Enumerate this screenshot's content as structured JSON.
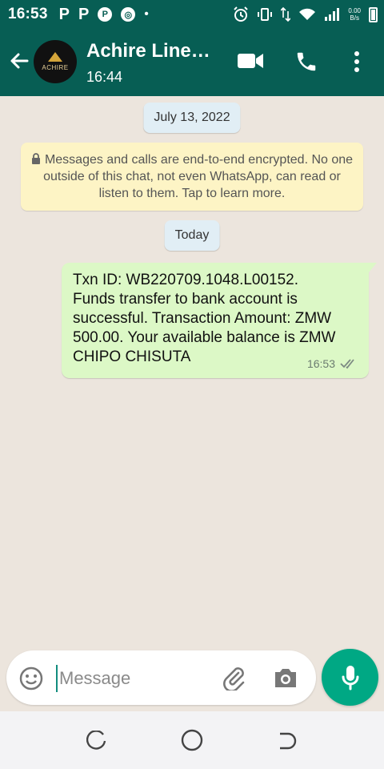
{
  "status_bar": {
    "time": "16:53",
    "left_icons": [
      "P",
      "P",
      "P",
      "chrome"
    ],
    "dot": "•",
    "speed_top": "0.00",
    "speed_bottom": "B/s",
    "right_icons": [
      "alarm-icon",
      "vibrate-icon",
      "data-arrows-icon",
      "wifi-icon",
      "signal-icon",
      "battery-icon"
    ]
  },
  "header": {
    "contact_name": "Achire Line…",
    "last_seen": "16:44",
    "avatar_text": "ACHIRE",
    "icons": [
      "back-arrow-icon",
      "video-call-icon",
      "voice-call-icon",
      "more-options-icon"
    ]
  },
  "chat": {
    "date_chip": "July 13, 2022",
    "encryption_notice": "Messages and calls are end-to-end encrypted. No one outside of this chat, not even WhatsApp, can read or listen to them. Tap to learn more.",
    "today_chip": "Today",
    "message": {
      "text": "Txn ID: WB220709.1048.L00152. Funds transfer to bank account is successful. Transaction Amount: ZMW 500.00. Your available balance is ZMW CHIPO CHISUTA",
      "time": "16:53",
      "status": "delivered"
    }
  },
  "composer": {
    "placeholder": "Message",
    "icons": [
      "emoji-icon",
      "attach-icon",
      "camera-icon",
      "mic-icon"
    ]
  },
  "colors": {
    "header": "#075e54",
    "accent": "#00a884",
    "outgoing_bubble": "#dcf8c6",
    "background": "#ece5dd",
    "notice": "#fdf4c5"
  }
}
